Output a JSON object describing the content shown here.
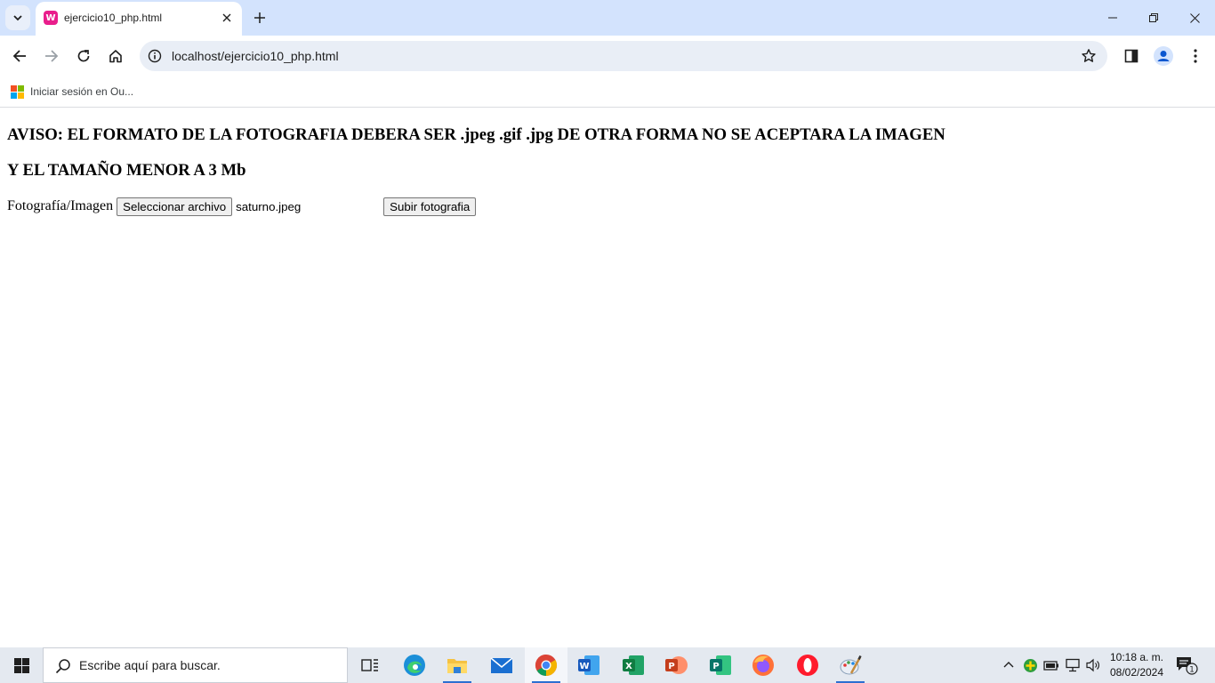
{
  "browser": {
    "tab_title": "ejercicio10_php.html",
    "favicon_letter": "W",
    "url": "localhost/ejercicio10_php.html",
    "bookmark_label": "Iniciar sesión en Ou..."
  },
  "page": {
    "notice_line1": "AVISO: EL FORMATO DE LA FOTOGRAFIA DEBERA SER .jpeg .gif .jpg DE OTRA FORMA NO SE ACEPTARA LA IMAGEN",
    "notice_line2": "Y EL TAMAÑO MENOR A 3 Mb",
    "field_label": "Fotografía/Imagen",
    "file_button_label": "Seleccionar archivo",
    "selected_file": "saturno.jpeg",
    "submit_label": "Subir fotografia"
  },
  "taskbar": {
    "search_placeholder": "Escribe aquí para buscar.",
    "time": "10:18 a. m.",
    "date": "08/02/2024",
    "notification_count": "1",
    "apps": [
      "task-view",
      "edge",
      "file-explorer",
      "mail",
      "chrome",
      "word",
      "excel",
      "powerpoint",
      "publisher",
      "firefox",
      "opera",
      "paint"
    ]
  },
  "colors": {
    "tabstrip": "#d3e3fd",
    "omnibox": "#e9eef6",
    "taskbar": "#e4e9f0",
    "favicon": "#e91e8c",
    "accent": "#2d6fd1"
  }
}
